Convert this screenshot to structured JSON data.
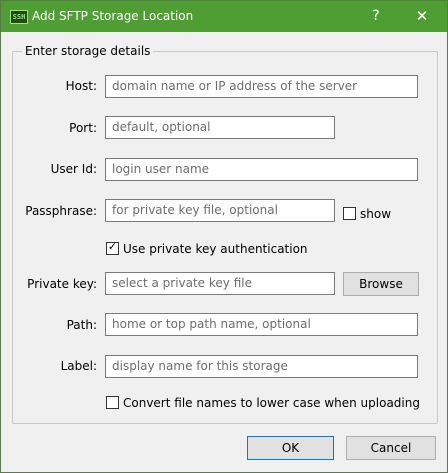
{
  "window": {
    "title": "Add SFTP Storage Location",
    "app_icon_text": "SSH",
    "help_glyph": "?",
    "close_glyph": "✕"
  },
  "group": {
    "title": "Enter storage details"
  },
  "fields": {
    "host": {
      "label": "Host:",
      "placeholder": "domain name or IP address of the server"
    },
    "port": {
      "label": "Port:",
      "placeholder": "default, optional"
    },
    "user_id": {
      "label": "User Id:",
      "placeholder": "login user name"
    },
    "passphrase": {
      "label": "Passphrase:",
      "placeholder": "for private key file, optional"
    },
    "private_key": {
      "label": "Private key:",
      "placeholder": "select a private key file"
    },
    "path": {
      "label": "Path:",
      "placeholder": "home or top path name, optional"
    },
    "label": {
      "label": "Label:",
      "placeholder": "display name for this storage"
    }
  },
  "checkboxes": {
    "show": {
      "label": "show",
      "checked": false
    },
    "use_private_key": {
      "label": "Use private key authentication",
      "checked": true,
      "mark": "✓"
    },
    "lowercase": {
      "label": "Convert file names to lower case when uploading",
      "checked": false
    }
  },
  "buttons": {
    "browse": "Browse",
    "ok": "OK",
    "cancel": "Cancel"
  },
  "colors": {
    "titlebar": "#4f9e33",
    "focus_border": "#0078d7"
  }
}
